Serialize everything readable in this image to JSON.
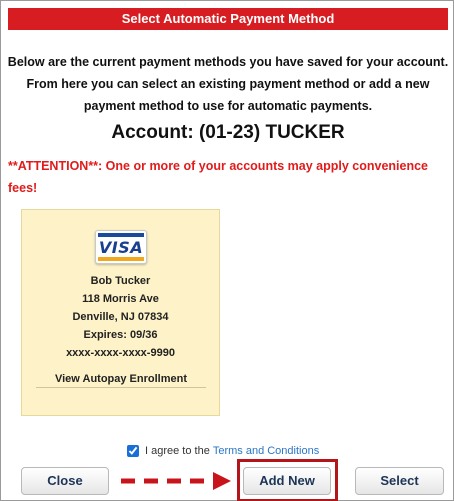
{
  "dialog": {
    "title": "Select Automatic Payment Method",
    "intro_lines": [
      "Below are the current payment methods you have saved for your account.",
      "From here you can select an existing payment method or add a new",
      "payment method to use for automatic payments."
    ],
    "account_heading": "Account: (01-23) TUCKER",
    "attention": "**ATTENTION**: One or more of your accounts may apply convenience fees!"
  },
  "card": {
    "brand": "VISA",
    "name": "Bob Tucker",
    "address1": "118 Morris Ave",
    "address2": "Denville, NJ 07834",
    "expires": "Expires: 09/36",
    "number": "xxxx-xxxx-xxxx-9990",
    "link_label": "View Autopay Enrollment"
  },
  "agreement": {
    "checked": true,
    "text": "I agree to the",
    "link_text": "Terms and Conditions"
  },
  "buttons": {
    "close": "Close",
    "add_new": "Add New",
    "select": "Select"
  },
  "colors": {
    "title_bar": "#d71c22",
    "attention_text": "#e11b1b",
    "highlight": "#b3151b",
    "card_bg": "#fdf2c8"
  }
}
